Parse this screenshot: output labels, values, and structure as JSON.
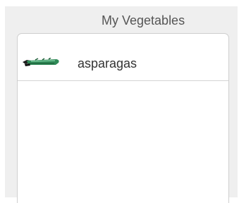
{
  "panel": {
    "title": "My Vegetables"
  },
  "list": {
    "items": [
      {
        "label": "asparagas",
        "icon": "asparagus-icon"
      }
    ]
  },
  "colors": {
    "panel_background": "#efefef",
    "card_background": "#ffffff",
    "asparagus_green": "#2f8a57"
  }
}
